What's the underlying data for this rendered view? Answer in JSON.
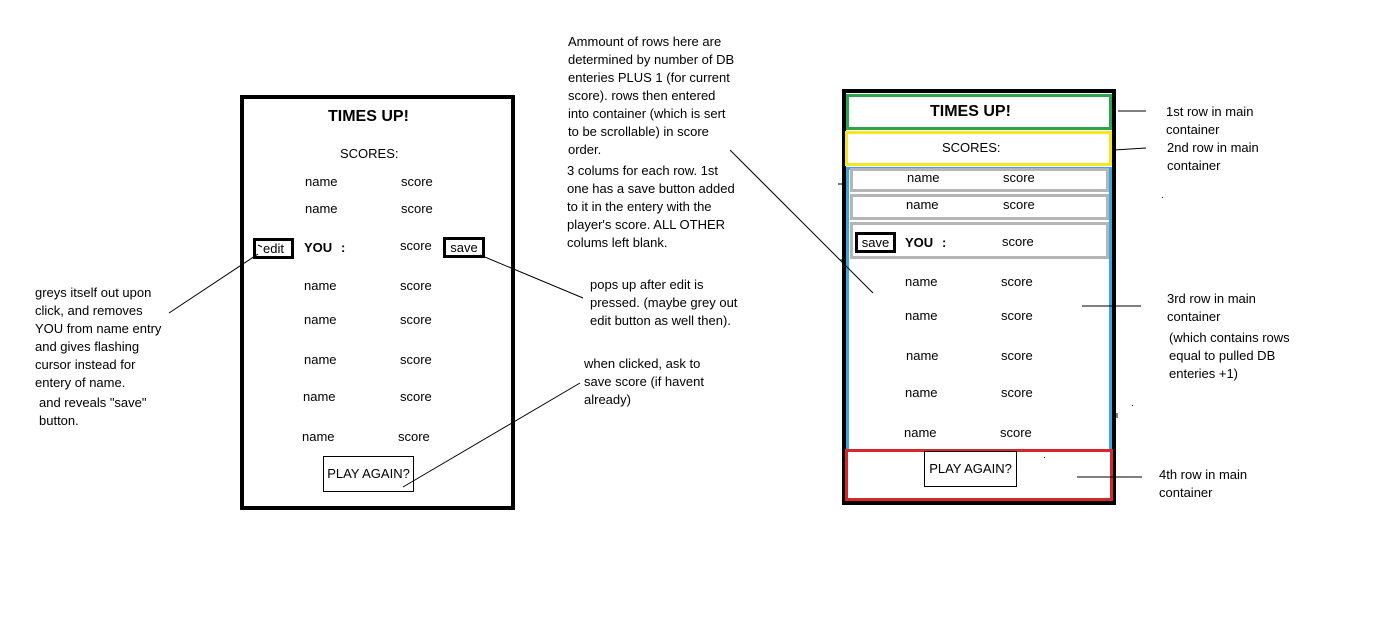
{
  "colors": {
    "row1_border": "#2ea44f",
    "row2_border": "#f5e61d",
    "row3_border": "#3aa6dc",
    "row4_border": "#d8262a",
    "inner_row_border": "#b5b5b5",
    "frame": "#000000"
  },
  "left_mockup": {
    "title": "TIMES UP!",
    "scores_label": "SCORES:",
    "rows": [
      {
        "name": "name",
        "score": "score"
      },
      {
        "name": "name",
        "score": "score"
      },
      {
        "name": "YOU",
        "sep": ":",
        "score": "score",
        "left_button": "edit",
        "right_button": "save"
      },
      {
        "name": "name",
        "score": "score"
      },
      {
        "name": "name",
        "score": "score"
      },
      {
        "name": "name",
        "score": "score"
      },
      {
        "name": "name",
        "score": "score"
      },
      {
        "name": "name",
        "score": "score"
      }
    ],
    "play_again": "PLAY AGAIN?"
  },
  "right_mockup": {
    "title": "TIMES UP!",
    "scores_label": "SCORES:",
    "rows": [
      {
        "name": "name",
        "score": "score"
      },
      {
        "name": "name",
        "score": "score"
      },
      {
        "name": "YOU",
        "sep": ":",
        "score": "score",
        "left_button": "save"
      },
      {
        "name": "name",
        "score": "score"
      },
      {
        "name": "name",
        "score": "score"
      },
      {
        "name": "name",
        "score": "score"
      },
      {
        "name": "name",
        "score": "score"
      },
      {
        "name": "name",
        "score": "score"
      }
    ],
    "play_again": "PLAY AGAIN?"
  },
  "annotations": {
    "edit_note": "greys itself out upon\nclick, and removes\nYOU from name entry\nand gives flashing\ncursor instead for\nentery of name.",
    "edit_note_2": "and reveals \"save\"\nbutton.",
    "rows_note": "Ammount of rows here are\ndetermined by number of DB\nenteries PLUS 1 (for current\nscore). rows then entered\ninto container (which is sert\nto be scrollable) in score\norder.",
    "columns_note": "3 colums for each row. 1st\none has a save button added\nto it in the entery with the\nplayer's score. ALL OTHER\ncolums left blank.",
    "save_note": "pops up after edit is\npressed. (maybe grey out\nedit button as well then).",
    "play_again_note": "when clicked, ask to\nsave score (if havent\nalready)",
    "row1_note": "1st row in main\ncontainer",
    "row2_note": "2nd row in main\ncontainer",
    "row3_note": "3rd row in main\ncontainer",
    "row3_note_2": "(which contains rows\nequal to pulled DB\nenteries +1)",
    "row4_note": "4th row in main\ncontainer"
  }
}
